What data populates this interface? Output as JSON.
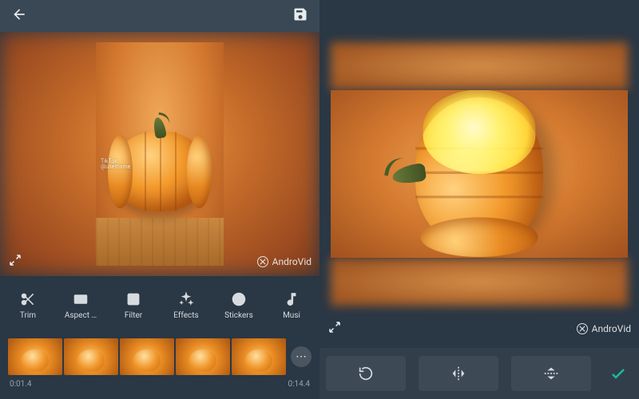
{
  "left": {
    "watermark_label": "AndroVid",
    "watermark_tiktok_line1": "TikTok",
    "watermark_tiktok_line2": "@username",
    "tools": {
      "trim": "Trim",
      "aspect": "Aspect …",
      "filter": "Filter",
      "effects": "Effects",
      "stickers": "Stickers",
      "music": "Musi"
    },
    "time_current": "0:01.4",
    "time_total": "0:14.4"
  },
  "right": {
    "watermark_label": "AndroVid"
  }
}
